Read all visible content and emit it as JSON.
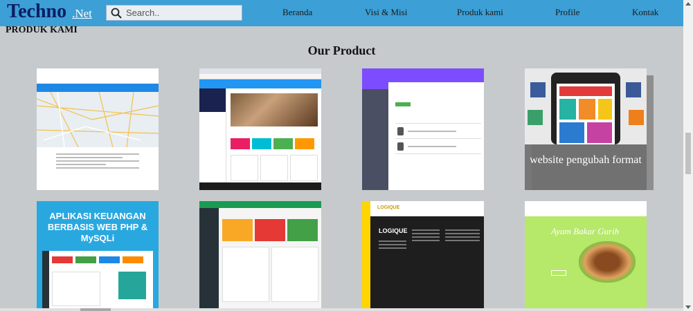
{
  "brand": {
    "name": "Techno",
    "suffix": ".Net"
  },
  "search": {
    "placeholder": "Search.."
  },
  "nav": [
    {
      "label": "Beranda"
    },
    {
      "label": "Visi & Misi"
    },
    {
      "label": "Produk kami"
    },
    {
      "label": "Profile"
    },
    {
      "label": "Kontak"
    }
  ],
  "page": {
    "section_title": "PRODUK KAMI",
    "heading": "Our Product"
  },
  "products": [
    {
      "name": "product-map",
      "caption": ""
    },
    {
      "name": "product-dashboard",
      "caption": ""
    },
    {
      "name": "product-admin",
      "caption": ""
    },
    {
      "name": "product-converter",
      "caption": "website pengubah format"
    },
    {
      "name": "product-keuangan",
      "caption": "APLIKASI KEUANGAN BERBASIS WEB PHP & MySQLi"
    },
    {
      "name": "product-green-admin",
      "caption": ""
    },
    {
      "name": "product-logique",
      "caption": "LOGIQUE"
    },
    {
      "name": "product-ayam-bakar",
      "caption": "Ayam Bakar Gurih"
    }
  ],
  "colors": {
    "navbar": "#3c9fd6",
    "brand_text": "#0b1e63",
    "page_bg": "#c6cacd"
  }
}
